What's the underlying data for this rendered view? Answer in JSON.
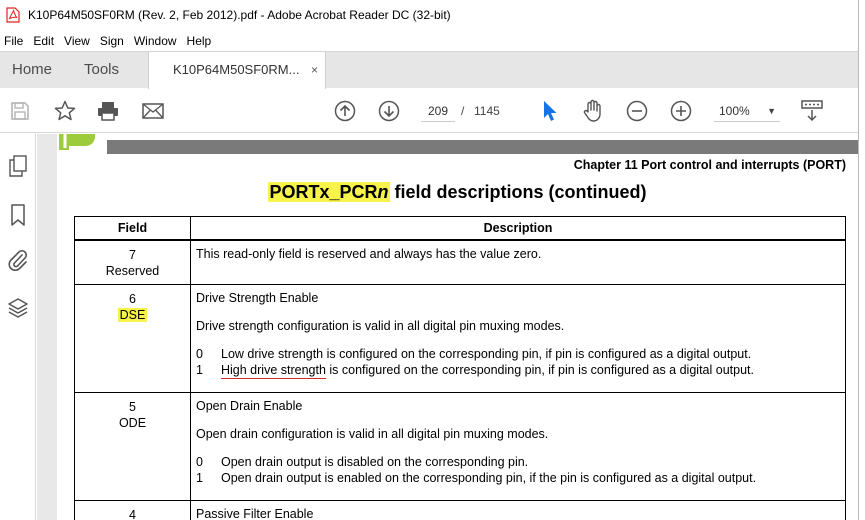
{
  "window": {
    "title": "K10P64M50SF0RM (Rev. 2, Feb 2012).pdf - Adobe Acrobat Reader DC (32-bit)"
  },
  "menu": [
    "File",
    "Edit",
    "View",
    "Sign",
    "Window",
    "Help"
  ],
  "tabs": {
    "home": "Home",
    "tools": "Tools",
    "document": "K10P64M50SF0RM...",
    "close": "×"
  },
  "toolbar": {
    "icons": [
      "save-icon",
      "bookmark-star-icon",
      "print-icon",
      "email-icon",
      "previous-page-icon",
      "next-page-icon",
      "select-cursor-icon",
      "hand-tool-icon",
      "zoom-out-icon",
      "zoom-in-icon",
      "read-mode-icon"
    ],
    "page_current": "209",
    "page_separator": "/",
    "page_total": "1145",
    "zoom": "100%",
    "zoom_caret": "▼"
  },
  "sidebar": {
    "icons": [
      "page-thumbnails-icon",
      "bookmarks-icon",
      "attachments-icon",
      "layers-icon"
    ]
  },
  "document": {
    "chapter": "Chapter 11 Port control and interrupts (PORT)",
    "table_title_highlight": "PORTx_PCR",
    "table_title_italic": "n",
    "table_title_rest": " field descriptions (continued)",
    "columns": [
      "Field",
      "Description"
    ],
    "rows": [
      {
        "field_num": "7",
        "field_name": "Reserved",
        "title": "This read-only field is reserved and always has the value zero."
      },
      {
        "field_num": "6",
        "field_name": "DSE",
        "title": "Drive Strength Enable",
        "note": "Drive strength configuration is valid in all digital pin muxing modes.",
        "v0_num": "0",
        "v0_text": "Low drive strength is configured on the corresponding pin, if pin is configured as a digital output.",
        "v1_num": "1",
        "v1_underlined": "High drive strength",
        "v1_text": " is configured on the corresponding pin, if pin is configured as a digital output."
      },
      {
        "field_num": "5",
        "field_name": "ODE",
        "title": "Open Drain Enable",
        "note": "Open drain configuration is valid in all digital pin muxing modes.",
        "v0_num": "0",
        "v0_text": "Open drain output is disabled on the corresponding pin.",
        "v1_num": "1",
        "v1_text": "Open drain output is enabled on the corresponding pin, if the pin is configured as a digital output."
      },
      {
        "field_num": "4",
        "title": "Passive Filter Enable"
      }
    ]
  },
  "colors": {
    "highlight": "#f8f34a",
    "underline": "#d02a2a",
    "acrobat_red": "#d9261c",
    "accent_blue": "#1473e6"
  }
}
